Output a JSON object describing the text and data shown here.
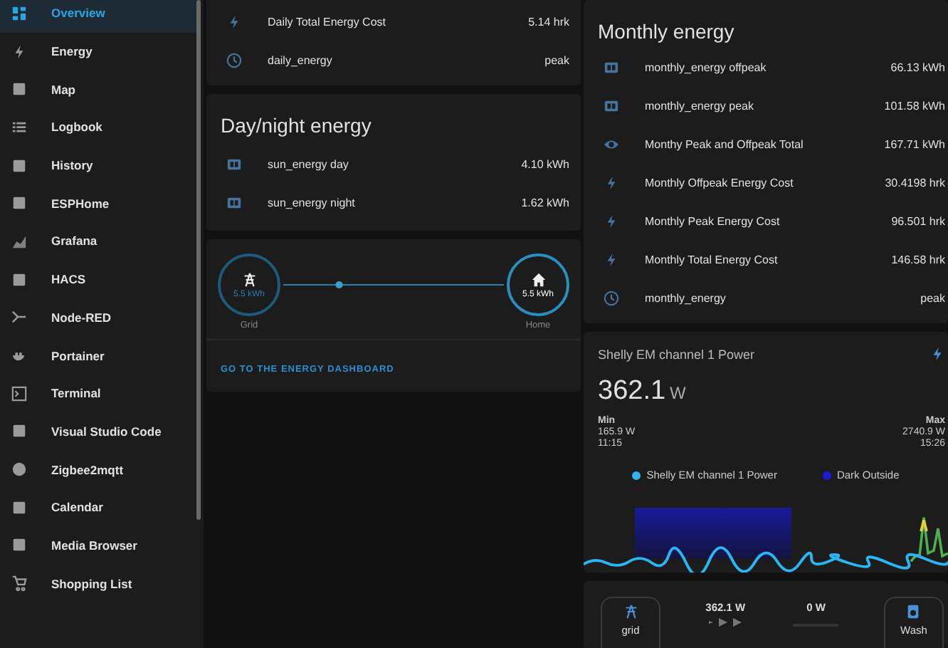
{
  "sidebar": {
    "items": [
      {
        "label": "Overview",
        "selected": true
      },
      {
        "label": "Energy",
        "selected": false
      },
      {
        "label": "Map",
        "selected": false
      },
      {
        "label": "Logbook",
        "selected": false
      },
      {
        "label": "History",
        "selected": false
      },
      {
        "label": "ESPHome",
        "selected": false
      },
      {
        "label": "Grafana",
        "selected": false
      },
      {
        "label": "HACS",
        "selected": false
      },
      {
        "label": "Node-RED",
        "selected": false
      },
      {
        "label": "Portainer",
        "selected": false
      },
      {
        "label": "Terminal",
        "selected": false
      },
      {
        "label": "Visual Studio Code",
        "selected": false
      },
      {
        "label": "Zigbee2mqtt",
        "selected": false
      },
      {
        "label": "Calendar",
        "selected": false
      },
      {
        "label": "Media Browser",
        "selected": false
      },
      {
        "label": "Shopping List",
        "selected": false
      }
    ]
  },
  "daily_card": {
    "rows": [
      {
        "kind": "bolt",
        "name": "Daily Total Energy Cost",
        "value": "5.14 hrk"
      },
      {
        "kind": "clock",
        "name": "daily_energy",
        "value": "peak"
      }
    ]
  },
  "day_night_card": {
    "title": "Day/night energy",
    "rows": [
      {
        "kind": "meter",
        "name": "sun_energy day",
        "value": "4.10 kWh"
      },
      {
        "kind": "meter",
        "name": "sun_energy night",
        "value": "1.62 kWh"
      }
    ]
  },
  "energy_flow": {
    "grid": {
      "label": "Grid",
      "value": "5.5 kWh"
    },
    "home": {
      "label": "Home",
      "value": "5.5 kWh"
    },
    "link": "GO TO THE ENERGY DASHBOARD"
  },
  "monthly_card": {
    "title": "Monthly energy",
    "rows": [
      {
        "kind": "meter",
        "name": "monthly_energy offpeak",
        "value": "66.13 kWh"
      },
      {
        "kind": "meter",
        "name": "monthly_energy peak",
        "value": "101.58 kWh"
      },
      {
        "kind": "eye",
        "name": "Monthy Peak and Offpeak Total",
        "value": "167.71 kWh"
      },
      {
        "kind": "bolt",
        "name": "Monthly Offpeak Energy Cost",
        "value": "30.4198 hrk"
      },
      {
        "kind": "bolt",
        "name": "Monthly Peak Energy Cost",
        "value": "96.501 hrk"
      },
      {
        "kind": "bolt",
        "name": "Monthly Total Energy Cost",
        "value": "146.58 hrk"
      },
      {
        "kind": "clock",
        "name": "monthly_energy",
        "value": "peak"
      }
    ]
  },
  "power_card": {
    "title": "Shelly EM channel 1 Power",
    "value": "362.1",
    "unit": "W",
    "min": {
      "label": "Min",
      "value": "165.9 W",
      "time": "11:15"
    },
    "max": {
      "label": "Max",
      "value": "2740.9 W",
      "time": "15:26"
    },
    "legend": [
      {
        "name": "Shelly EM channel 1 Power",
        "color": "#29b6f6"
      },
      {
        "name": "Dark Outside",
        "color": "#1a1ad8"
      }
    ]
  },
  "flow_strip": {
    "grid_label": "grid",
    "power": "362.1 W",
    "zero": "0 W",
    "device_label": "Wash"
  }
}
